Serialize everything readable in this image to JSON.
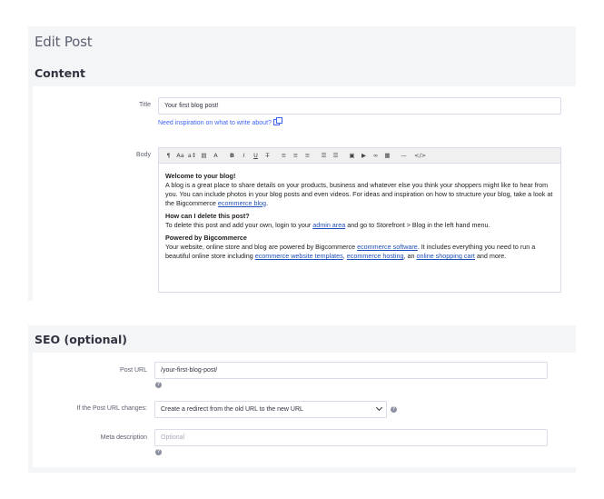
{
  "page": {
    "title": "Edit Post"
  },
  "content": {
    "section_title": "Content",
    "title_label": "Title",
    "title_value": "Your first blog post!",
    "help_link": "Need inspiration on what to write about?",
    "body_label": "Body",
    "toolbar": [
      "¶",
      "Aa",
      "a↕",
      "▤",
      "A",
      "B",
      "I",
      "U",
      "T̶",
      "≡",
      "≡",
      "≡",
      "☰",
      "☰",
      "▣",
      "▶",
      "∞",
      "▦",
      "—",
      "</>"
    ],
    "body": {
      "p1_heading": "Welcome to your blog!",
      "p1_text_a": "A blog is a great place to share details on your products, business and whatever else you think your shoppers might like to hear from you. You can include photos in your blog posts and even videos. For ideas and inspiration on how to structure your blog, take a look at the Bigcommerce ",
      "p1_link": "ecommerce blog",
      "p1_text_b": ".",
      "p2_heading": "How can I delete this post?",
      "p2_text_a": "To delete this post and add your own, login to your ",
      "p2_link": "admin area",
      "p2_text_b": " and go to Storefront > Blog in the left hand menu.",
      "p3_heading": "Powered by Bigcommerce",
      "p3_text_a": "Your website, online store and blog are powered by Bigcommerce ",
      "p3_link1": "ecommerce software",
      "p3_text_b": ". It includes everything you need to run a beautiful online store including ",
      "p3_link2": "ecommerce website templates",
      "p3_text_c": ", ",
      "p3_link3": "ecommerce hosting",
      "p3_text_d": ", an ",
      "p3_link4": "online shopping cart",
      "p3_text_e": " and more."
    }
  },
  "seo": {
    "section_title": "SEO (optional)",
    "post_url_label": "Post URL",
    "post_url_value": "/your-first-blog-post/",
    "url_change_label": "If the Post URL changes:",
    "url_change_value": "Create a redirect from the old URL to the new URL",
    "meta_label": "Meta description",
    "meta_placeholder": "Optional"
  },
  "icons": {
    "help": "?"
  }
}
